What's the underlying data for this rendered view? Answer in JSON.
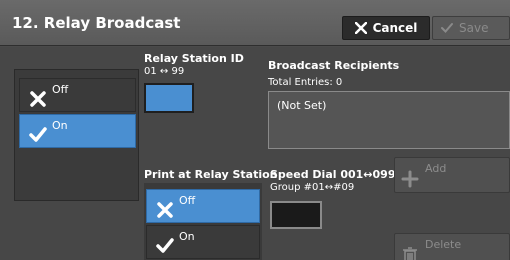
{
  "header": {
    "title": "12. Relay Broadcast",
    "cancel_label": "Cancel",
    "save_label": "Save"
  },
  "relay_broadcast": {
    "options": [
      {
        "label": "Off",
        "selected": false
      },
      {
        "label": "On",
        "selected": true
      }
    ]
  },
  "relay_station_id": {
    "label": "Relay Station ID",
    "range": "01 ↔ 99"
  },
  "broadcast_recipients": {
    "label": "Broadcast Recipients",
    "total_entries": "Total Entries: 0",
    "value": "(Not Set)"
  },
  "print_at_relay_station": {
    "label": "Print at Relay Station",
    "options": [
      {
        "label": "Off",
        "selected": true
      },
      {
        "label": "On",
        "selected": false
      }
    ]
  },
  "speed_dial": {
    "label": "Speed Dial 001↔099",
    "group": "Group #01↔#09"
  },
  "actions": {
    "add_label": "Add",
    "delete_label": "Delete"
  },
  "colors": {
    "selected": "#4a8fd1",
    "panel": "#3b3b3b",
    "background": "#474747"
  }
}
